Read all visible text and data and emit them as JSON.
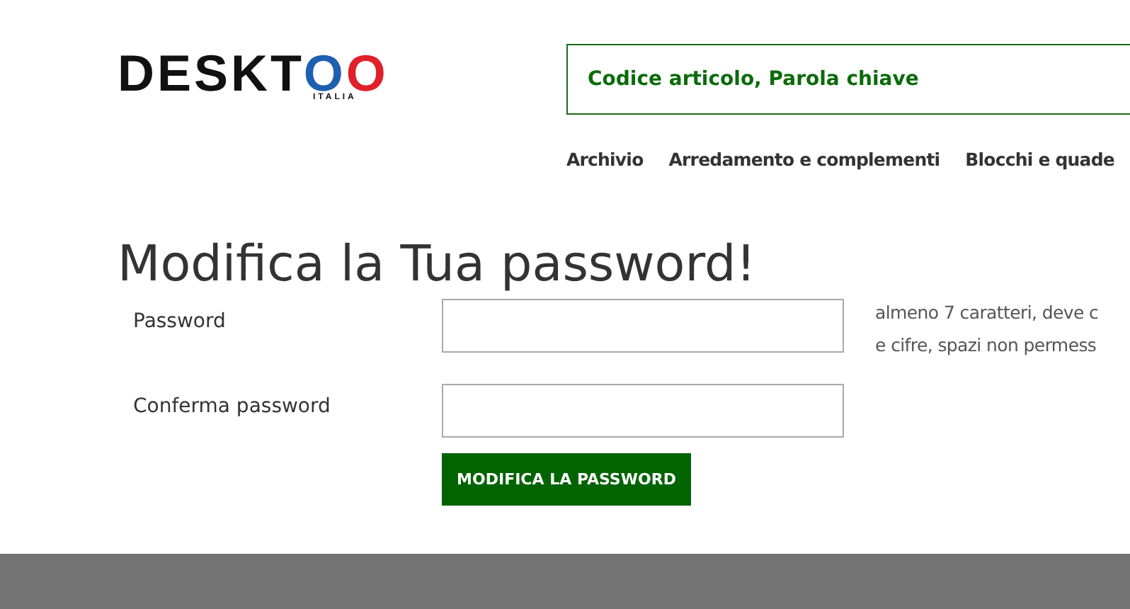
{
  "logo": {
    "name": "DESKT",
    "accents": [
      {
        "letter": "O",
        "color": "#1f5fb0"
      },
      {
        "letter": "O",
        "color": "#e0202a"
      }
    ],
    "tagline": "ITALIA"
  },
  "search": {
    "placeholder": "Codice articolo, Parola chiave"
  },
  "nav": [
    "Archivio",
    "Arredamento e complementi",
    "Blocchi e quade"
  ],
  "title": "Modifica la Tua password!",
  "fields": [
    {
      "label": "Password"
    },
    {
      "label": "Conferma password"
    }
  ],
  "hint": [
    "almeno 7 caratteri, deve c",
    "e cifre, spazi non permess"
  ],
  "submit": "MODIFICA LA PASSWORD"
}
